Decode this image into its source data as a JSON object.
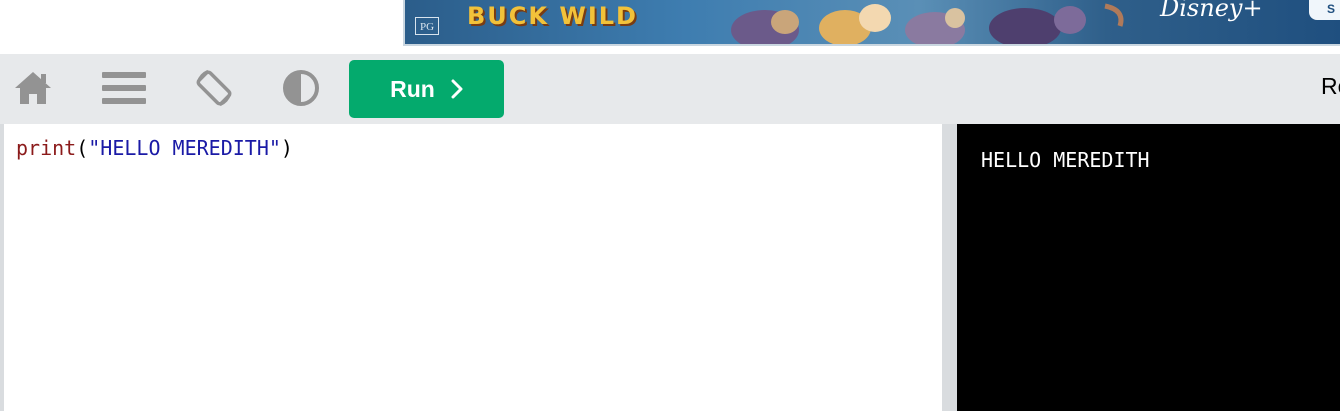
{
  "ad": {
    "rating": "PG",
    "title": "BUCK WILD",
    "brand": "Disney+",
    "button_label": "S"
  },
  "toolbar": {
    "icons": [
      "home-icon",
      "menu-icon",
      "rotate-screen-icon",
      "contrast-icon"
    ],
    "run_label": "Run",
    "right_text": "Re"
  },
  "editor": {
    "func": "print",
    "open_paren": "(",
    "string": "\"HELLO MEREDITH\"",
    "close_paren": ")"
  },
  "output": {
    "text": "HELLO MEREDITH"
  },
  "colors": {
    "run_button": "#04aa6d",
    "toolbar_bg": "#e7e9eb",
    "icon_gray": "#939393",
    "keyword": "#8b1a1a",
    "string": "#1a1aa6",
    "output_bg": "#000000"
  }
}
